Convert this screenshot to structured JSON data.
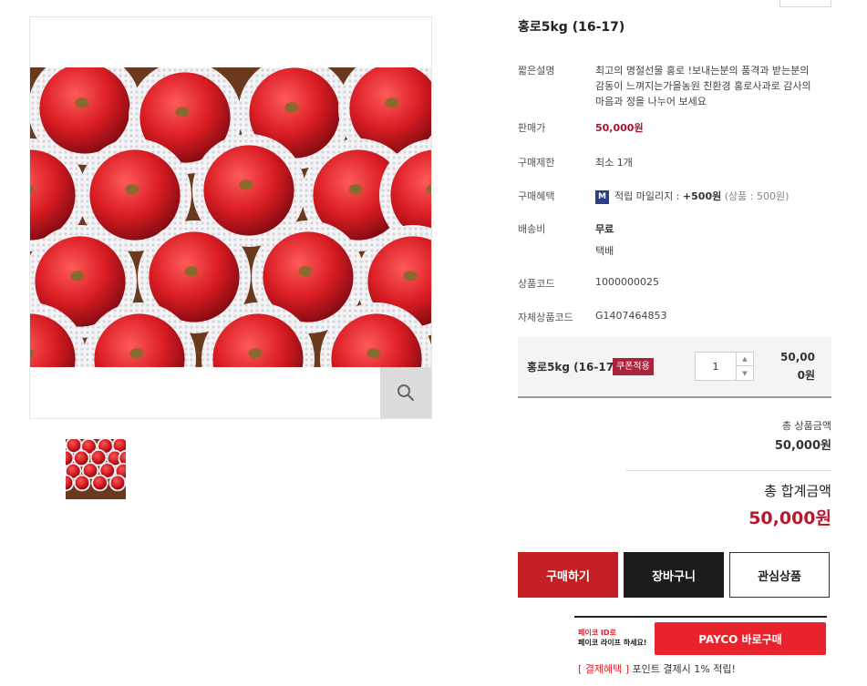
{
  "product": {
    "title": "홍로5kg (16-17)",
    "image_alt": "apples"
  },
  "details": [
    {
      "label": "짧은설명",
      "value": "최고의 명절선물 홍로 !보내는분의 품격과 받는분의 감동이 느껴지는가을농원 친환경 홍로사과로 감사의 마음과 정을 나누어 보세요"
    },
    {
      "label": "판매가",
      "value": "50,000원"
    },
    {
      "label": "구매제한",
      "value": "최소 1개"
    },
    {
      "label": "구매혜택",
      "badge": "M",
      "mileage_prefix": "적립 마일리지 : ",
      "mileage_value": "+500원",
      "mileage_note": "(상품 : 500원)"
    },
    {
      "label": "배송비",
      "value": "무료",
      "value2": "택배"
    },
    {
      "label": "상품코드",
      "value": "1000000025"
    },
    {
      "label": "자체상품코드",
      "value": "G1407464853"
    }
  ],
  "option": {
    "name": "홍로5kg (16-17)",
    "coupon_label": "쿠폰적용",
    "quantity": "1",
    "up_arrow": "▲",
    "down_arrow": "▼",
    "price": "50,000원"
  },
  "totals": {
    "subtotal_label": "총 상품금액",
    "subtotal_value": "50,000원",
    "total_label": "총 합계금액",
    "total_value": "50,000원"
  },
  "buttons": {
    "buy": "구매하기",
    "cart": "장바구니",
    "wish": "관심상품"
  },
  "payco": {
    "promo_line1": "페이코 ID로",
    "promo_line2": "페이코 라이프 하세요!",
    "button": "PAYCO 바로구매",
    "benefit_tag": "[ 결제혜택 ]",
    "benefit_text": " 포인트 결제시 1% 적립!"
  },
  "colors": {
    "accent": "#c41f25",
    "price": "#a6162f",
    "total": "#b8182f",
    "coupon": "#a8233c",
    "mileage_badge": "#2b3e86",
    "payco": "#e8232b"
  },
  "icons": {
    "zoom": "magnifier-icon",
    "mileage": "mileage-m-icon"
  }
}
